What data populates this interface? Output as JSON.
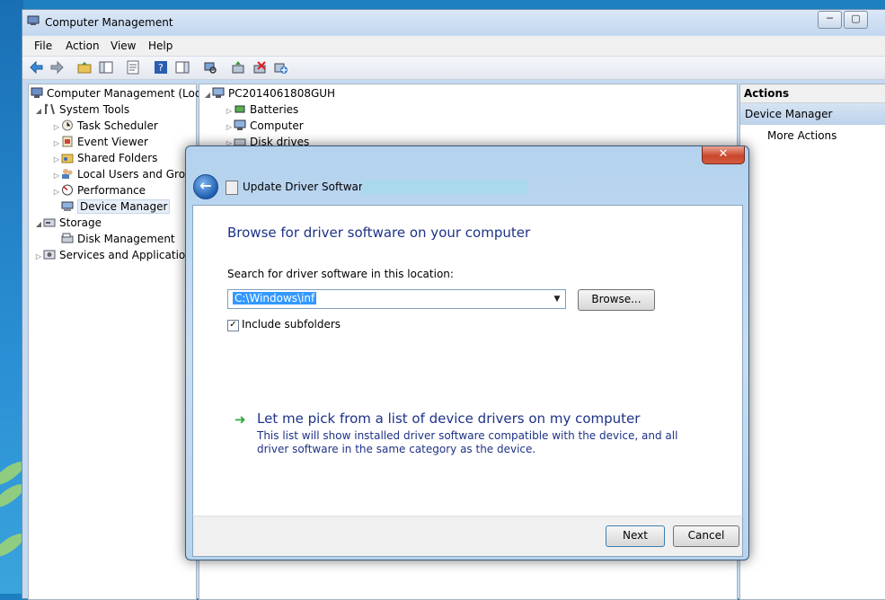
{
  "window": {
    "title": "Computer Management",
    "controls": {
      "minimize": "─",
      "maximize": "▢"
    }
  },
  "menu": [
    "File",
    "Action",
    "View",
    "Help"
  ],
  "tree": {
    "root": "Computer Management (Local",
    "items": [
      {
        "label": "System Tools",
        "level": 1,
        "expanded": true
      },
      {
        "label": "Task Scheduler",
        "level": 2
      },
      {
        "label": "Event Viewer",
        "level": 2
      },
      {
        "label": "Shared Folders",
        "level": 2
      },
      {
        "label": "Local Users and Group",
        "level": 2
      },
      {
        "label": "Performance",
        "level": 2
      },
      {
        "label": "Device Manager",
        "level": 2,
        "selected": true
      },
      {
        "label": "Storage",
        "level": 1,
        "expanded": true
      },
      {
        "label": "Disk Management",
        "level": 2
      },
      {
        "label": "Services and Applications",
        "level": 1
      }
    ]
  },
  "devices": {
    "computer": "PC2014061808GUH",
    "items": [
      "Batteries",
      "Computer",
      "Disk drives"
    ]
  },
  "actions": {
    "header": "Actions",
    "section": "Device Manager",
    "more": "More Actions"
  },
  "dialog": {
    "close": "✕",
    "title": "Update Driver Software -",
    "heading": "Browse for driver software on your computer",
    "search_label": "Search for driver software in this location:",
    "path_value": "C:\\Windows\\inf",
    "browse_label": "Browse...",
    "include_subfolders": "Include subfolders",
    "include_checked": true,
    "pick_title": "Let me pick from a list of device drivers on my computer",
    "pick_desc": "This list will show installed driver software compatible with the device, and all driver software in the same category as the device.",
    "next_label": "Next",
    "cancel_label": "Cancel"
  },
  "colors": {
    "link_blue": "#1e3287",
    "selection": "#3399ff",
    "green_arrow": "#2ea83a"
  }
}
